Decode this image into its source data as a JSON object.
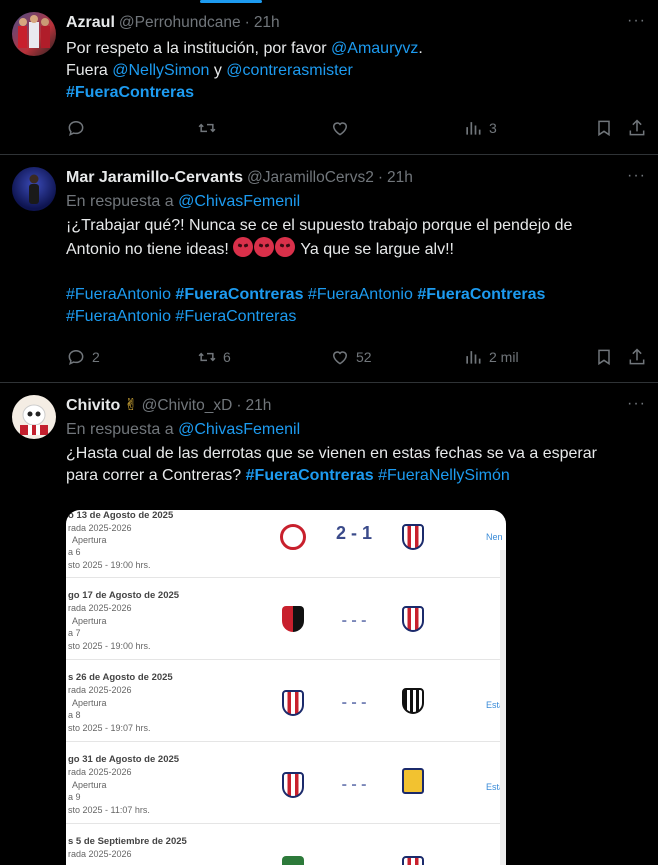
{
  "tweets": [
    {
      "name": "Azraul",
      "handle": "@Perrohundcane",
      "time": "21h",
      "more": "···",
      "text": {
        "l1a": "Por respeto a la institución, por favor ",
        "l1b": "@Amauryvz",
        "l1c": ".",
        "l2a": "Fuera ",
        "l2b": "@NellySimon",
        "l2c": " y ",
        "l2d": "@contrerasmister",
        "l3": "#FueraContreras"
      },
      "views": "3"
    },
    {
      "name": "Mar Jaramillo-Cervants",
      "handle": "@JaramilloCervs2",
      "time": "21h",
      "more": "···",
      "reply_prefix": "En respuesta a ",
      "reply_to": "@ChivasFemenil",
      "text": {
        "l1": "¡¿Trabajar qué?! Nunca se ce el supuesto trabajo porque el pendejo de",
        "l2a": "Antonio no tiene ideas! ",
        "l2b": " Ya que se largue alv!!",
        "t1": "#FueraAntonio",
        "t2": "#FueraContreras",
        "t3": "#FueraAntonio",
        "t4": "#FueraContreras",
        "t5": "#FueraAntonio",
        "t6": "#FueraContreras"
      },
      "replies": "2",
      "reposts": "6",
      "likes": "52",
      "views": "2 mil"
    },
    {
      "name": "Chivito",
      "emoji": "✌",
      "handle": "@Chivito_xD",
      "time": "21h",
      "more": "···",
      "reply_prefix": "En respuesta a ",
      "reply_to": "@ChivasFemenil",
      "text": {
        "l1": "¿Hasta cual de las derrotas que se vienen en estas fechas se va a esperar",
        "l2a": "para correr a Contreras? ",
        "l2b": "#FueraContreras",
        "l2c": " #FueraNellySimón"
      }
    }
  ],
  "media": {
    "rows": [
      {
        "date": "o 13 de Agosto de 2025",
        "season": "rada 2025-2026",
        "phase": "Apertura",
        "round": "a 6",
        "time": "sto 2025 - 19:00 hrs.",
        "score": "2 - 1",
        "side": "Nen"
      },
      {
        "date": "go 17 de Agosto de 2025",
        "season": "rada 2025-2026",
        "phase": "Apertura",
        "round": "a 7",
        "time": "sto 2025 - 19:00 hrs.",
        "score": "- - -",
        "side": ""
      },
      {
        "date": "s 26 de Agosto de 2025",
        "season": "rada 2025-2026",
        "phase": "Apertura",
        "round": "a 8",
        "time": "sto 2025 - 19:07 hrs.",
        "score": "- - -",
        "side": "Esta"
      },
      {
        "date": "go 31 de Agosto de 2025",
        "season": "rada 2025-2026",
        "phase": "Apertura",
        "round": "a 9",
        "time": "sto 2025 - 11:07 hrs.",
        "score": "- - -",
        "side": "Esta"
      },
      {
        "date": "s 5 de Septiembre de 2025",
        "season": "rada 2025-2026",
        "phase": "Apertura",
        "round": "",
        "time": "",
        "score": "",
        "side": ""
      }
    ]
  },
  "colors": {
    "accent": "#1d9bf0",
    "bg": "#000000",
    "muted": "#71767b",
    "divider": "#2f3336"
  }
}
